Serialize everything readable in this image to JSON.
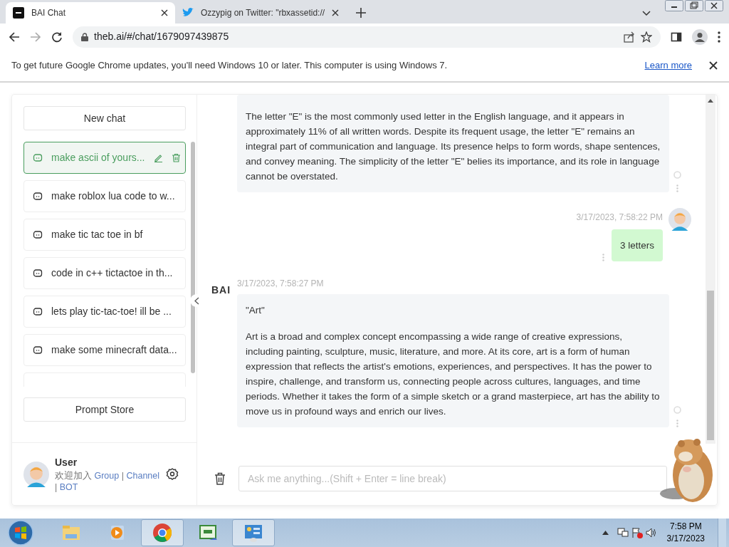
{
  "browser": {
    "tabs": [
      {
        "title": "BAI Chat",
        "selected": true,
        "kind": "bai"
      },
      {
        "title": "Ozzypig on Twitter: \"rbxassetid://",
        "selected": false,
        "kind": "twitter"
      }
    ],
    "url": "theb.ai/#/chat/1679097439875",
    "infobar": {
      "text": "To get future Google Chrome updates, you'll need Windows 10 or later. This computer is using Windows 7.",
      "link": "Learn more"
    }
  },
  "sidebar": {
    "new_chat": "New chat",
    "chats": [
      {
        "title": "make ascii of yours...",
        "selected": true
      },
      {
        "title": "make roblox lua code to w...",
        "selected": false
      },
      {
        "title": "make tic tac toe in bf",
        "selected": false
      },
      {
        "title": "code in c++ tictactoe in th...",
        "selected": false
      },
      {
        "title": "lets play tic-tac-toe! ill be ...",
        "selected": false
      },
      {
        "title": "make some minecraft data...",
        "selected": false
      }
    ],
    "prompt_store": "Prompt Store",
    "user": {
      "name": "User",
      "welcome": "欢迎加入",
      "separator": "|",
      "links": [
        "Group",
        "Channel",
        "BOT"
      ]
    }
  },
  "messages": [
    {
      "kind": "bot",
      "paragraphs": [
        "The letter \"E\" is the most commonly used letter in the English language, and it appears in approximately 11% of all written words. Despite its frequent usage, the letter \"E\" remains an integral part of communication and language. Its presence helps to form words, shape sentences, and convey meaning. The simplicity of the letter \"E\" belies its importance, and its role in language cannot be overstated."
      ]
    },
    {
      "kind": "user",
      "time": "3/17/2023, 7:58:22 PM",
      "paragraphs": [
        "3 letters"
      ]
    },
    {
      "kind": "bot",
      "time": "3/17/2023, 7:58:27 PM",
      "logo": "BAI",
      "paragraphs": [
        "\"Art\"",
        "Art is a broad and complex concept encompassing a wide range of creative expressions, including painting, sculpture, music, literature, and more. At its core, art is a form of human expression that reflects the artist's emotions, experiences, and perspectives. It has the power to inspire, challenge, and transform us, connecting people across cultures, languages, and time periods. Whether it takes the form of a simple sketch or a grand masterpiece, art has the ability to move us in profound ways and enrich our lives."
      ]
    }
  ],
  "input": {
    "placeholder": "Ask me anything...(Shift + Enter = line break)"
  },
  "taskbar": {
    "apps": [
      {
        "kind": "explorer",
        "selected": false
      },
      {
        "kind": "media",
        "selected": false
      },
      {
        "kind": "chrome",
        "selected": true
      },
      {
        "kind": "csharp",
        "selected": false
      },
      {
        "kind": "control",
        "selected": true
      }
    ],
    "time": "7:58 PM",
    "date": "3/17/2023"
  }
}
